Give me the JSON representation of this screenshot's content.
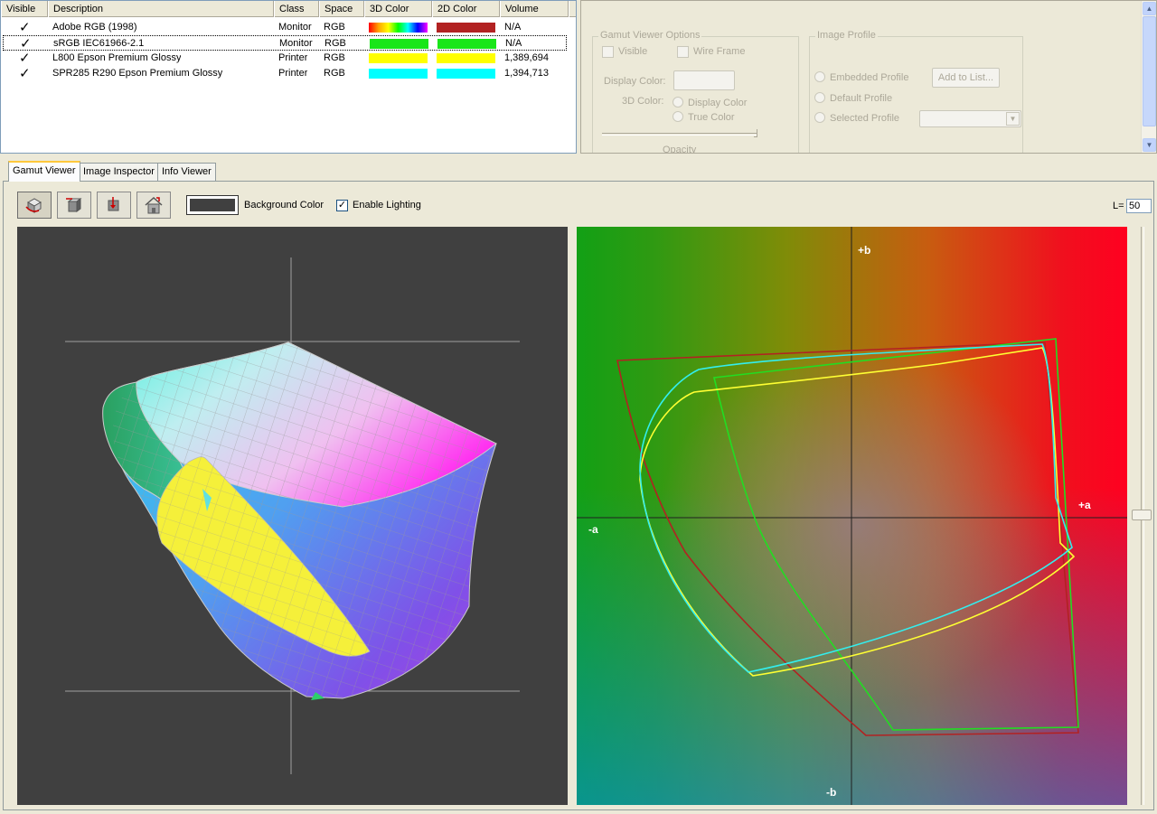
{
  "table": {
    "columns": [
      "Visible",
      "Description",
      "Class",
      "Space",
      "3D Color",
      "2D Color",
      "Volume"
    ],
    "rows": [
      {
        "visible": "✓",
        "description": "Adobe RGB (1998)",
        "class": "Monitor",
        "space": "RGB",
        "volume": "N/A",
        "color3d": "rainbow",
        "color2d": "#b22222"
      },
      {
        "visible": "✓",
        "description": "sRGB IEC61966-2.1",
        "class": "Monitor",
        "space": "RGB",
        "volume": "N/A",
        "color3d": "#19e619",
        "color2d": "#19e619"
      },
      {
        "visible": "✓",
        "description": "L800 Epson Premium Glossy",
        "class": "Printer",
        "space": "RGB",
        "volume": "1,389,694",
        "color3d": "#ffff00",
        "color2d": "#ffff00"
      },
      {
        "visible": "✓",
        "description": "SPR285 R290 Epson Premium Glossy",
        "class": "Printer",
        "space": "RGB",
        "volume": "1,394,713",
        "color3d": "#00ffff",
        "color2d": "#00ffff"
      }
    ]
  },
  "gamut_options": {
    "title": "Gamut Viewer Options",
    "visible_label": "Visible",
    "wire_frame_label": "Wire Frame",
    "display_color_label": "Display Color:",
    "color3d_label": "3D Color:",
    "display_color_radio": "Display Color",
    "true_color_radio": "True Color",
    "opacity_label": "Opacity"
  },
  "image_profile": {
    "title": "Image Profile",
    "embedded": "Embedded Profile",
    "default": "Default Profile",
    "selected": "Selected Profile",
    "add_button": "Add to List..."
  },
  "tabs": [
    "Gamut Viewer",
    "Image Inspector",
    "Info Viewer"
  ],
  "toolbar": {
    "background_color_label": "Background Color",
    "enable_lighting_label": "Enable Lighting",
    "enable_lighting_checked": "✓",
    "l_label": "L=",
    "l_value": "50",
    "background_color": "#404040"
  },
  "plot2d": {
    "labels": {
      "plus_b": "+b",
      "minus_b": "-b",
      "plus_a": "+a",
      "minus_a": "-a"
    }
  },
  "icons": [
    "rotate-view-icon",
    "cube-front-icon",
    "cube-top-icon",
    "home-view-icon"
  ]
}
